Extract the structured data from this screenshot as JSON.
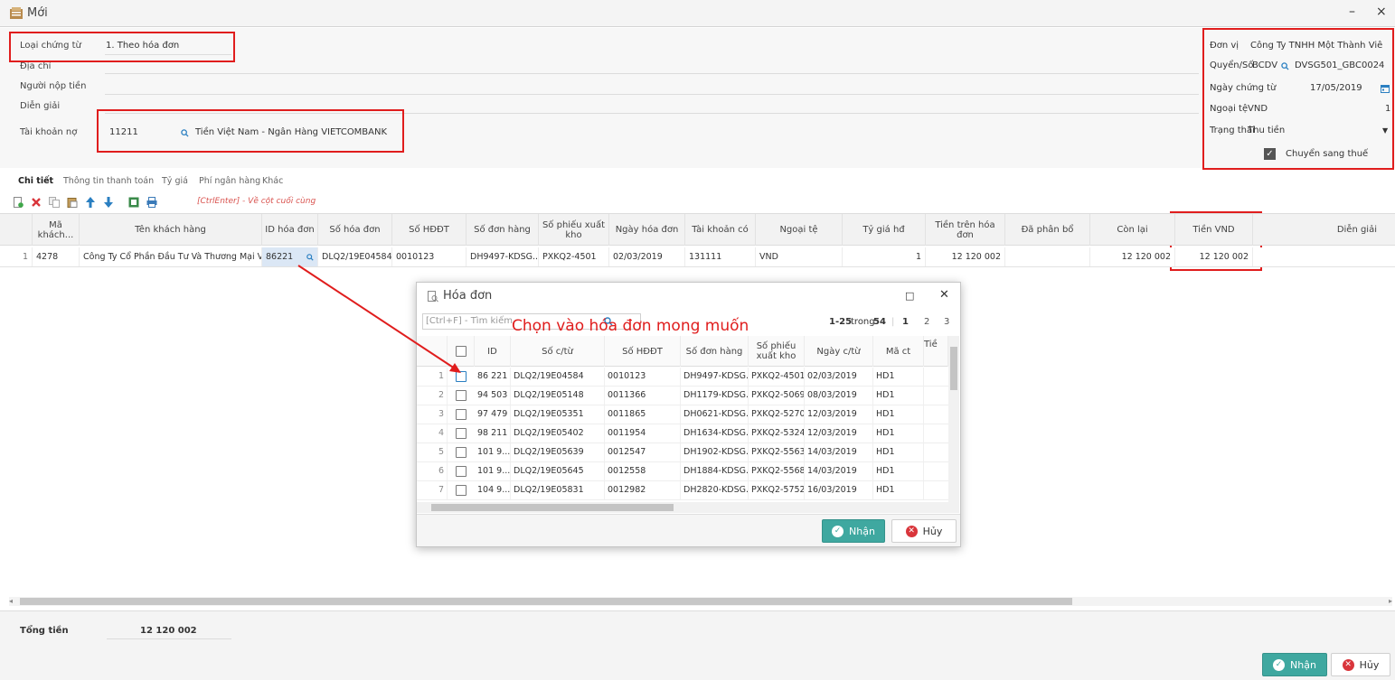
{
  "window": {
    "title": "Mới",
    "minimize_glyph": "–",
    "close_glyph": "×"
  },
  "form_left": {
    "voucher_type": {
      "label": "Loại chứng từ",
      "value": "1. Theo hóa đơn"
    },
    "address": {
      "label": "Địa chỉ",
      "value": ""
    },
    "payer": {
      "label": "Người nộp tiền",
      "value": ""
    },
    "description": {
      "label": "Diễn giải",
      "value": ""
    },
    "debit_account": {
      "label": "Tài khoản nợ",
      "code": "11211",
      "name": "Tiền Việt Nam - Ngân Hàng VIETCOMBANK"
    }
  },
  "form_right": {
    "unit": {
      "label": "Đơn vị",
      "value": "Công Ty TNHH Một Thành Viê"
    },
    "book_no": {
      "label": "Quyển/Số",
      "book": "BCDV",
      "number": "DVSG501_GBC0024"
    },
    "voucher_date": {
      "label": "Ngày chứng từ",
      "value": "17/05/2019"
    },
    "currency": {
      "label": "Ngoại tệ",
      "value": "VND",
      "rate": "1"
    },
    "status": {
      "label": "Trạng thái",
      "value": "Thu tiền"
    },
    "transfer_tax": {
      "label": "Chuyển sang thuế",
      "checked": true
    }
  },
  "tabs": [
    "Chi tiết",
    "Thông tin thanh toán",
    "Tỷ giá",
    "Phí ngân hàng",
    "Khác"
  ],
  "toolbar": {
    "hint": "[CtrlEnter] - Về cột cuối cùng",
    "icons": [
      "new-row-icon",
      "delete-icon",
      "copy-icon",
      "paste-icon",
      "move-up-icon",
      "move-down-icon",
      "excel-icon",
      "print-icon"
    ]
  },
  "grid": {
    "headers": {
      "ma_khach": "Mã khách...",
      "ten_khach": "Tên khách hàng",
      "id_hoa_don": "ID hóa đơn",
      "so_hoa_don": "Số hóa đơn",
      "so_hddt": "Số HĐĐT",
      "so_don_hang": "Số đơn hàng",
      "so_phieu_xuat": "Số phiếu xuất kho",
      "ngay_hoa_don": "Ngày hóa đơn",
      "tai_khoan_co": "Tài khoản có",
      "ngoai_te": "Ngoại tệ",
      "ty_gia_hd": "Tỷ giá hđ",
      "tien_tren_hd": "Tiền trên hóa đơn",
      "da_phan_bo": "Đã phân bổ",
      "con_lai": "Còn lại",
      "tien_vnd": "Tiền VND",
      "dien_giai": "Diễn giải"
    },
    "row": {
      "stt": "1",
      "ma_khach": "4278",
      "ten_khach": "Công Ty Cổ Phần Đầu Tư Và Thương Mại V...",
      "id_hoa_don": "86221",
      "so_hoa_don": "DLQ2/19E04584",
      "so_hddt": "0010123",
      "so_don_hang": "DH9497-KDSG...",
      "so_phieu_xuat": "PXKQ2-4501",
      "ngay_hoa_don": "02/03/2019",
      "tai_khoan_co": "131111",
      "ngoai_te": "VND",
      "ty_gia_hd": "1",
      "tien_tren_hd": "12 120 002",
      "da_phan_bo": "",
      "con_lai": "12 120 002",
      "tien_vnd": "12 120 002",
      "dien_giai": ""
    }
  },
  "footer": {
    "total_label": "Tổng tiền",
    "total_value": "12 120 002",
    "ok": "Nhận",
    "cancel": "Hủy"
  },
  "dialog": {
    "title": "Hóa đơn",
    "search_placeholder": "[Ctrl+F] - Tìm kiếm",
    "pager": {
      "range": "1-25",
      "of": "trong",
      "total": "54",
      "pages": [
        "1",
        "2",
        "3"
      ]
    },
    "headers": [
      "ID",
      "Số c/từ",
      "Số HĐĐT",
      "Số đơn hàng",
      "Số phiếu xuất kho",
      "Ngày c/từ",
      "Mã ct",
      "Tiề"
    ],
    "rows": [
      {
        "n": "1",
        "id": "86 221",
        "so_ct": "DLQ2/19E04584",
        "hddt": "0010123",
        "don_hang": "DH9497-KDSG...",
        "phieu_xuat": "PXKQ2-4501",
        "ngay": "02/03/2019",
        "ma_ct": "HD1"
      },
      {
        "n": "2",
        "id": "94 503",
        "so_ct": "DLQ2/19E05148",
        "hddt": "0011366",
        "don_hang": "DH1179-KDSG...",
        "phieu_xuat": "PXKQ2-5069",
        "ngay": "08/03/2019",
        "ma_ct": "HD1"
      },
      {
        "n": "3",
        "id": "97 479",
        "so_ct": "DLQ2/19E05351",
        "hddt": "0011865",
        "don_hang": "DH0621-KDSG...",
        "phieu_xuat": "PXKQ2-5270",
        "ngay": "12/03/2019",
        "ma_ct": "HD1"
      },
      {
        "n": "4",
        "id": "98 211",
        "so_ct": "DLQ2/19E05402",
        "hddt": "0011954",
        "don_hang": "DH1634-KDSG...",
        "phieu_xuat": "PXKQ2-5324",
        "ngay": "12/03/2019",
        "ma_ct": "HD1"
      },
      {
        "n": "5",
        "id": "101 9...",
        "so_ct": "DLQ2/19E05639",
        "hddt": "0012547",
        "don_hang": "DH1902-KDSG...",
        "phieu_xuat": "PXKQ2-5563",
        "ngay": "14/03/2019",
        "ma_ct": "HD1"
      },
      {
        "n": "6",
        "id": "101 9...",
        "so_ct": "DLQ2/19E05645",
        "hddt": "0012558",
        "don_hang": "DH1884-KDSG...",
        "phieu_xuat": "PXKQ2-5568",
        "ngay": "14/03/2019",
        "ma_ct": "HD1"
      },
      {
        "n": "7",
        "id": "104 9...",
        "so_ct": "DLQ2/19E05831",
        "hddt": "0012982",
        "don_hang": "DH2820-KDSG...",
        "phieu_xuat": "PXKQ2-5752",
        "ngay": "16/03/2019",
        "ma_ct": "HD1"
      }
    ],
    "ok": "Nhận",
    "cancel": "Hủy",
    "restore_glyph": "□",
    "close_glyph": "✕"
  },
  "annotation": "Chọn vào hóa đơn mong muốn",
  "colors": {
    "highlight": "#e01d1d",
    "accent": "#3fa8a0",
    "cancel_icon": "#d9353b",
    "link_icon": "#2a7fc1"
  }
}
